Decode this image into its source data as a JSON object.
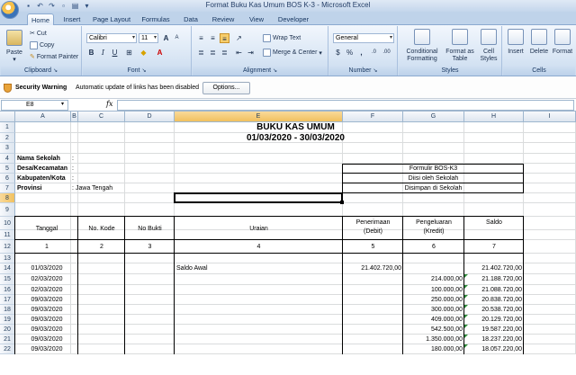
{
  "window": {
    "title": "Format Buku Kas Umum BOS K-3  -  Microsoft Excel"
  },
  "tabs": [
    "Home",
    "Insert",
    "Page Layout",
    "Formulas",
    "Data",
    "Review",
    "View",
    "Developer"
  ],
  "active_tab": "Home",
  "ribbon": {
    "clipboard": {
      "label": "Clipboard",
      "paste": "Paste",
      "cut": "Cut",
      "copy": "Copy",
      "format_painter": "Format Painter"
    },
    "font": {
      "label": "Font",
      "font_name": "Calibri",
      "font_size": "11",
      "bold": "B",
      "italic": "I",
      "underline": "U",
      "grow": "A",
      "shrink": "A"
    },
    "alignment": {
      "label": "Alignment",
      "wrap_text": "Wrap Text",
      "merge_center": "Merge & Center"
    },
    "number": {
      "label": "Number",
      "format": "General",
      "currency": "$",
      "percent": "%",
      "comma": ",",
      "inc_decimal": ".0",
      "dec_decimal": ".00"
    },
    "styles": {
      "label": "Styles",
      "conditional": "Conditional Formatting",
      "format_table": "Format as Table",
      "cell_styles": "Cell Styles"
    },
    "cells": {
      "label": "Cells",
      "insert": "Insert",
      "delete": "Delete",
      "format": "Format"
    }
  },
  "security": {
    "title": "Security Warning",
    "message": "Automatic update of links has been disabled",
    "options_button": "Options..."
  },
  "formula_bar": {
    "name_box": "E8",
    "fx": "fx",
    "formula": ""
  },
  "columns": [
    "A",
    "B",
    "C",
    "D",
    "E",
    "F",
    "G",
    "H",
    "I"
  ],
  "selected_column": "E",
  "rows": [
    "1",
    "2",
    "3",
    "4",
    "5",
    "6",
    "7",
    "8",
    "9",
    "10",
    "11",
    "12",
    "13",
    "14",
    "15",
    "16",
    "17",
    "18",
    "19",
    "20",
    "21",
    "22"
  ],
  "selected_row": "8",
  "sheet": {
    "title": "BUKU KAS UMUM",
    "period": "01/03/2020 - 30/03/2020",
    "info_labels": [
      "Nama Sekolah",
      "Desa/Kecamatan",
      "Kabupaten/Kota",
      "Provinsi"
    ],
    "colons": [
      ":",
      ":",
      ":",
      ":"
    ],
    "provinsi_value": "Jawa Tengah",
    "form_box": [
      "Formulir BOS-K3",
      "Diisi oleh Sekolah",
      "Disimpan di Sekolah"
    ],
    "headers": {
      "tanggal": "Tanggal",
      "no_kode": "No. Kode",
      "no_bukti": "No Bukti",
      "uraian": "Uraian",
      "penerimaan": "Penerimaan",
      "penerimaan_sub": "(Debit)",
      "pengeluaran": "Pengeluaran",
      "pengeluaran_sub": "(Kredit)",
      "saldo": "Saldo"
    },
    "col_numbers": [
      "1",
      "2",
      "3",
      "4",
      "5",
      "6",
      "7"
    ],
    "entries": [
      {
        "tanggal": "01/03/2020",
        "uraian": "Saldo Awal",
        "penerimaan": "21.402.720,00",
        "pengeluaran": "",
        "saldo": "21.402.720,00"
      },
      {
        "tanggal": "02/03/2020",
        "uraian": "",
        "penerimaan": "",
        "pengeluaran": "214.000,00",
        "saldo": "21.188.720,00"
      },
      {
        "tanggal": "02/03/2020",
        "uraian": "",
        "penerimaan": "",
        "pengeluaran": "100.000,00",
        "saldo": "21.088.720,00"
      },
      {
        "tanggal": "09/03/2020",
        "uraian": "",
        "penerimaan": "",
        "pengeluaran": "250.000,00",
        "saldo": "20.838.720,00"
      },
      {
        "tanggal": "09/03/2020",
        "uraian": "",
        "penerimaan": "",
        "pengeluaran": "300.000,00",
        "saldo": "20.538.720,00"
      },
      {
        "tanggal": "09/03/2020",
        "uraian": "",
        "penerimaan": "",
        "pengeluaran": "409.000,00",
        "saldo": "20.129.720,00"
      },
      {
        "tanggal": "09/03/2020",
        "uraian": "",
        "penerimaan": "",
        "pengeluaran": "542.500,00",
        "saldo": "19.587.220,00"
      },
      {
        "tanggal": "09/03/2020",
        "uraian": "",
        "penerimaan": "",
        "pengeluaran": "1.350.000,00",
        "saldo": "18.237.220,00"
      },
      {
        "tanggal": "09/03/2020",
        "uraian": "",
        "penerimaan": "",
        "pengeluaran": "180.000,00",
        "saldo": "18.057.220,00"
      }
    ]
  },
  "colors": {
    "selection_header": "#f1c15f",
    "ribbon": "#dbe7f5",
    "gridline": "#dadcdd",
    "error_indicator": "#2e8b3a"
  }
}
